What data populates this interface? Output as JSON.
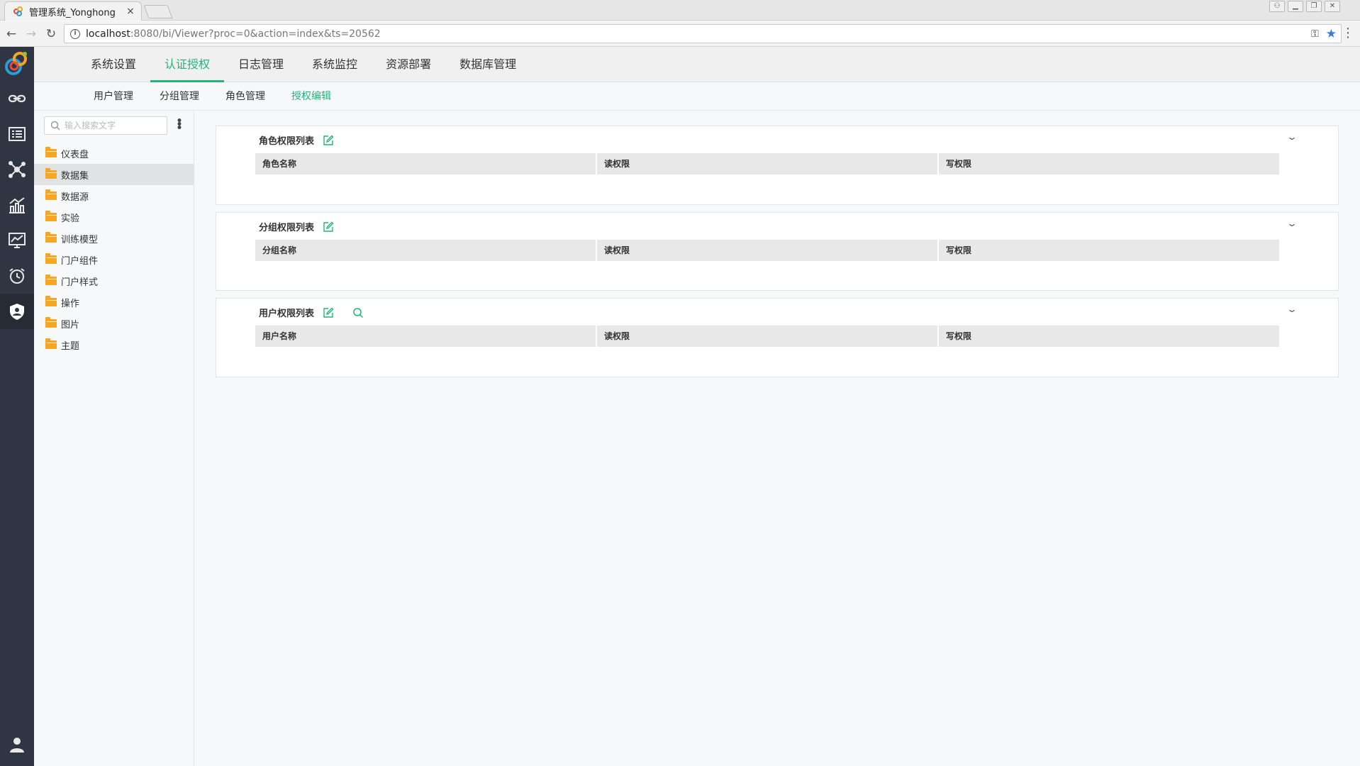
{
  "browser": {
    "tab_title": "管理系统_Yonghong",
    "tab_close": "×",
    "url_host": "localhost",
    "url_rest": ":8080/bi/Viewer?proc=0&action=index&ts=20562",
    "info_glyph": "i",
    "key_glyph": "⚿",
    "star_glyph": "★",
    "menu_glyph": "⋮",
    "back_glyph": "←",
    "forward_glyph": "→",
    "reload_glyph": "↻"
  },
  "topnav": {
    "items": [
      "系统设置",
      "认证授权",
      "日志管理",
      "系统监控",
      "资源部署",
      "数据库管理"
    ],
    "active_index": 1
  },
  "subnav": {
    "items": [
      "用户管理",
      "分组管理",
      "角色管理",
      "授权编辑"
    ],
    "active_index": 3
  },
  "tree": {
    "search_placeholder": "输入搜索文字",
    "items": [
      "仪表盘",
      "数据集",
      "数据源",
      "实验",
      "训练模型",
      "门户组件",
      "门户样式",
      "操作",
      "图片",
      "主题"
    ],
    "selected_index": 1
  },
  "panels": [
    {
      "title": "角色权限列表",
      "columns": [
        "角色名称",
        "读权限",
        "写权限"
      ],
      "has_search": false
    },
    {
      "title": "分组权限列表",
      "columns": [
        "分组名称",
        "读权限",
        "写权限"
      ],
      "has_search": false
    },
    {
      "title": "用户权限列表",
      "columns": [
        "用户名称",
        "读权限",
        "写权限"
      ],
      "has_search": true
    }
  ],
  "colors": {
    "accent": "#25b37a",
    "rail": "#2f3542",
    "folder": "#f5a623"
  }
}
